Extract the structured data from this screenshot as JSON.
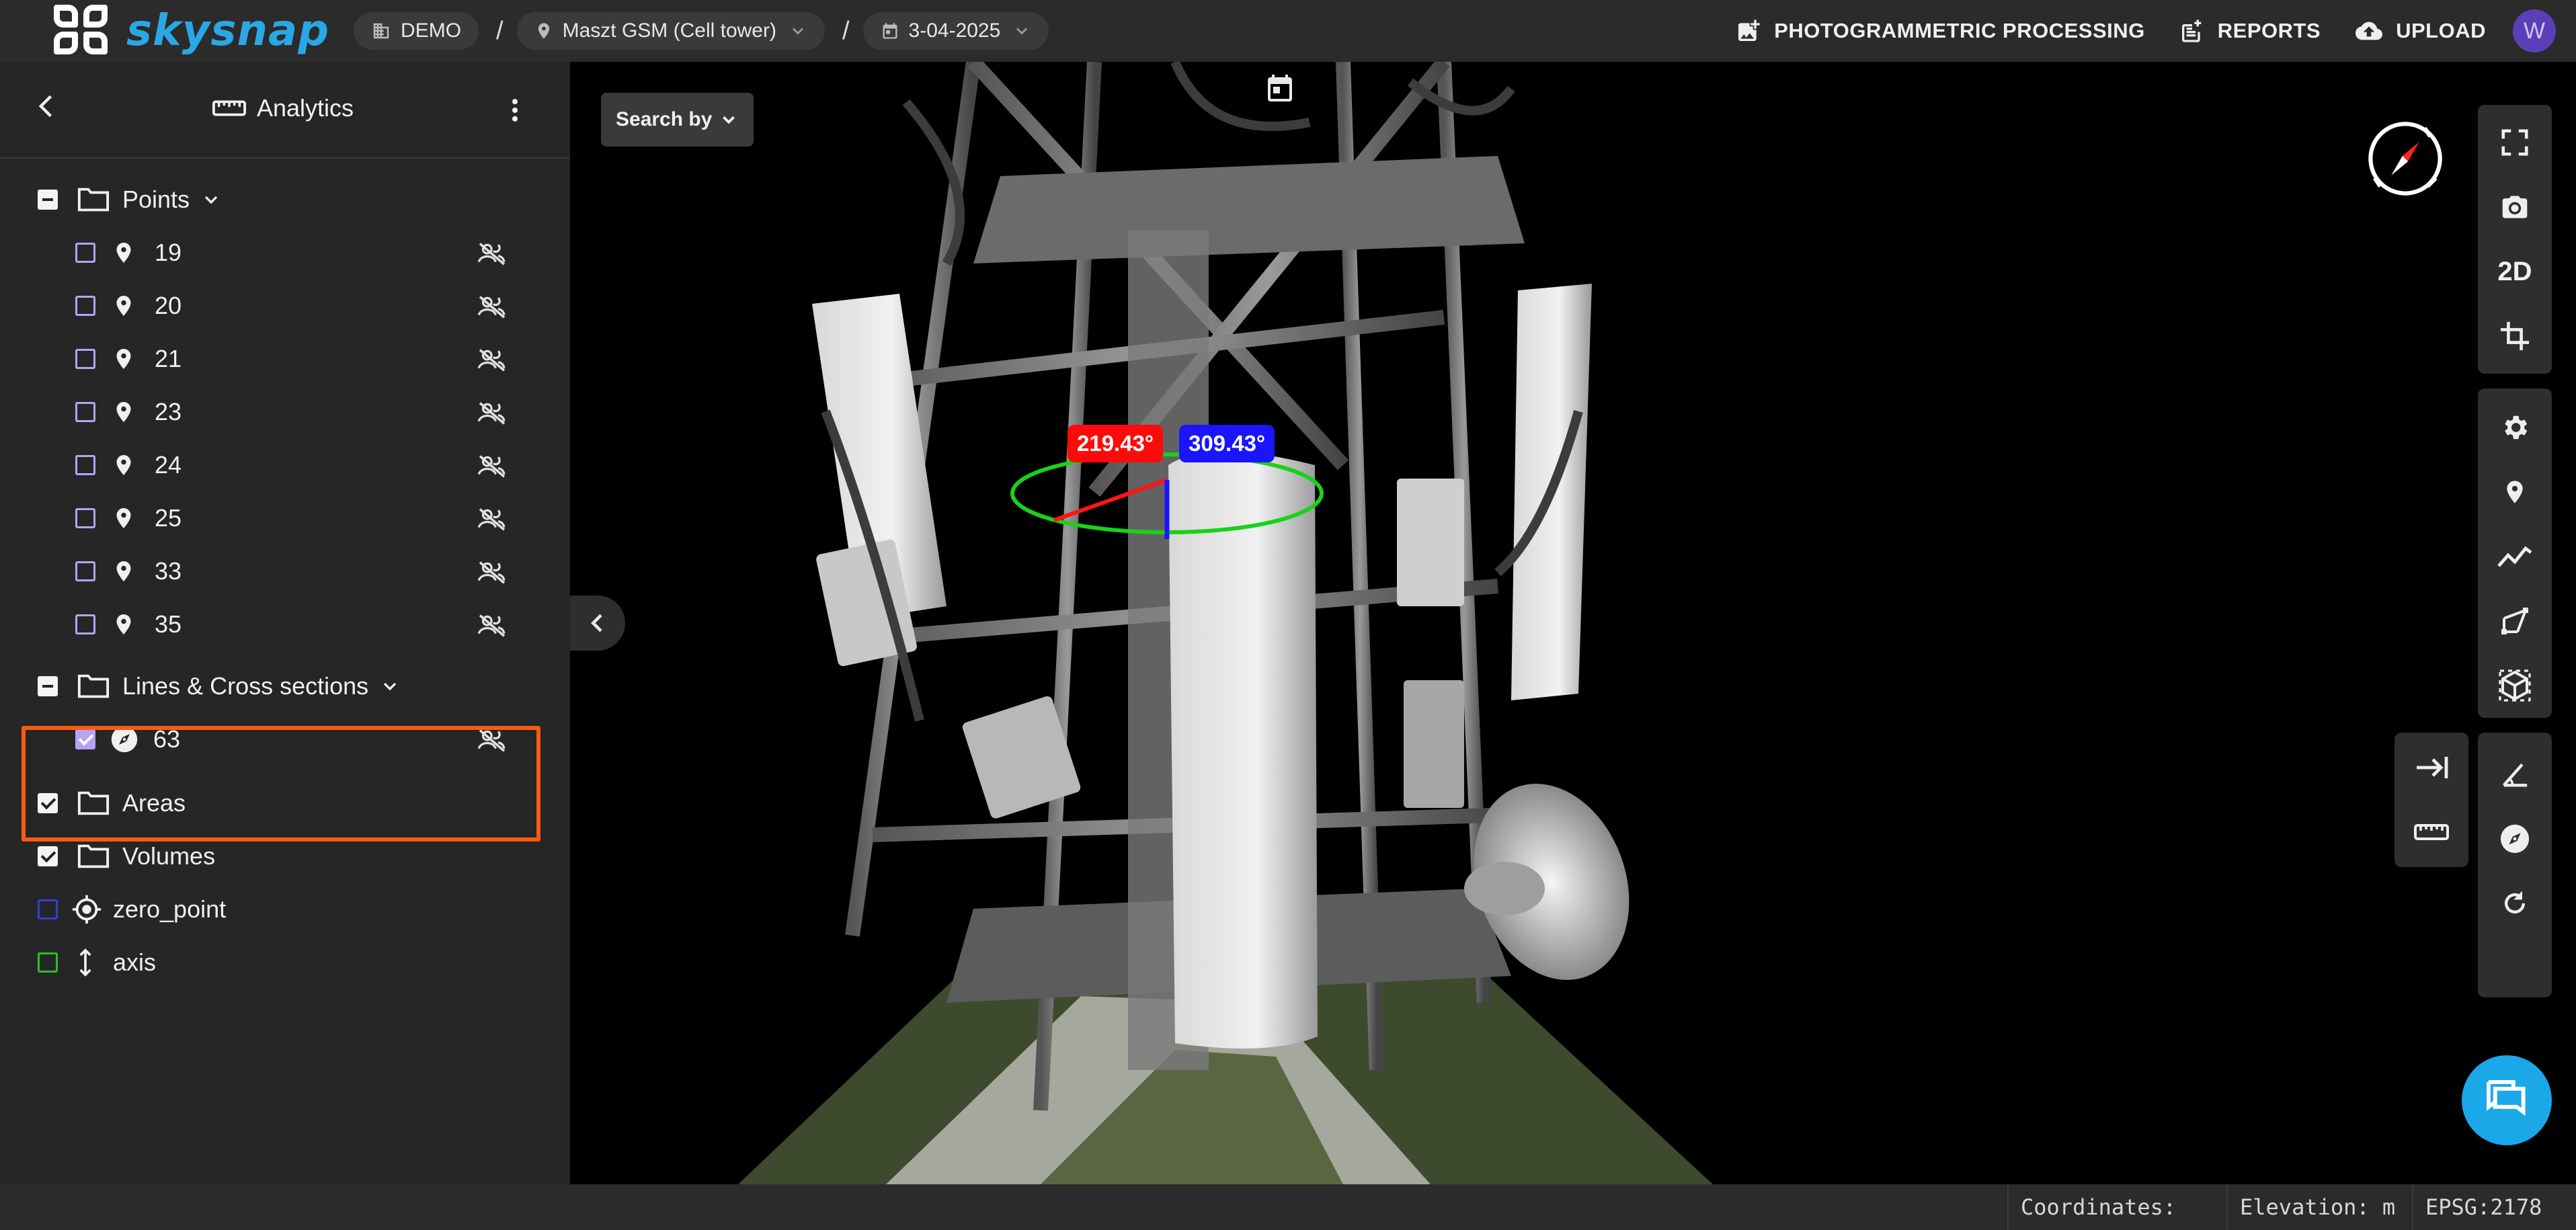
{
  "topbar": {
    "brand": "skysnap",
    "breadcrumbs": [
      {
        "label": "DEMO",
        "icon": "building-icon"
      },
      {
        "label": "Maszt GSM (Cell tower)",
        "icon": "location-pin-icon"
      },
      {
        "label": "3-04-2025",
        "icon": "calendar-icon"
      }
    ],
    "separator": "/",
    "actions": [
      {
        "label": "PHOTOGRAMMETRIC PROCESSING",
        "icon": "add-photo-icon"
      },
      {
        "label": "REPORTS",
        "icon": "report-icon"
      },
      {
        "label": "UPLOAD",
        "icon": "cloud-upload-icon"
      }
    ],
    "avatar_initial": "W"
  },
  "sidebar": {
    "title": "Analytics",
    "groups": {
      "points": {
        "label": "Points",
        "items": [
          {
            "label": "19"
          },
          {
            "label": "20"
          },
          {
            "label": "21"
          },
          {
            "label": "23"
          },
          {
            "label": "24"
          },
          {
            "label": "25"
          },
          {
            "label": "33"
          },
          {
            "label": "35"
          }
        ]
      },
      "lines": {
        "label": "Lines & Cross sections",
        "items": [
          {
            "label": "63",
            "checked": true
          }
        ]
      },
      "areas": {
        "label": "Areas",
        "checked": true
      },
      "volumes": {
        "label": "Volumes",
        "checked": true
      },
      "zero_point": {
        "label": "zero_point",
        "color": "#3040d8"
      },
      "axis": {
        "label": "axis",
        "color": "#28c228"
      }
    }
  },
  "viewport": {
    "search_by": "Search by",
    "angle_red": "219.43°",
    "angle_blue": "309.43°",
    "toolbar": {
      "view_mode": "2D"
    }
  },
  "statusbar": {
    "coordinates": "Coordinates:",
    "elevation": "Elevation: m",
    "epsg": "EPSG:2178"
  },
  "colors": {
    "accent": "#2aa7e5",
    "highlight": "#ff5a12",
    "checkbox_purple": "#b7a3f3",
    "angle_red": "#ff0a0a",
    "angle_blue": "#1a14ff",
    "chat": "#1aa8e8"
  }
}
